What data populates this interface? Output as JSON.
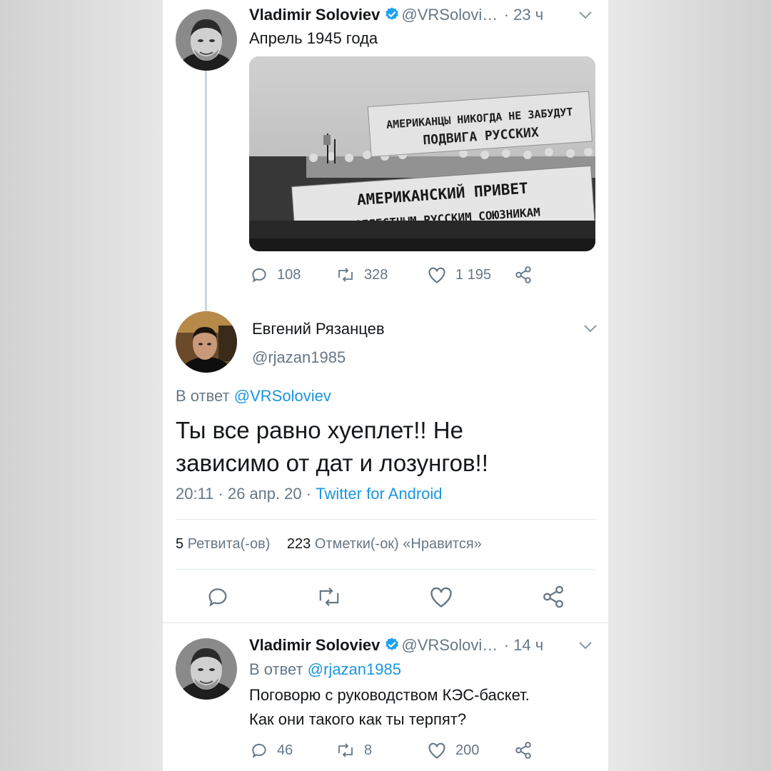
{
  "tweet1": {
    "name": "Vladimir Soloviev",
    "handle": "@VRSolovi…",
    "time": "· 23 ч",
    "text": "Апрель 1945 года",
    "media": {
      "banner_top_line1": "АМЕРИКАНЦЫ НИКОГДА НЕ ЗАБУДУТ",
      "banner_top_line2": "ПОДВИГА РУССКИХ",
      "banner_bottom_line1": "АМЕРИКАНСКИЙ ПРИВЕТ",
      "banner_bottom_line2": "ДОБЛЕСТНЫМ РУССКИМ СОЮЗНИКАМ"
    },
    "replies": "108",
    "retweets": "328",
    "likes": "1 195"
  },
  "tweet2": {
    "name": "Евгений Рязанцев",
    "handle": "@rjazan1985",
    "reply_prefix": "В ответ",
    "reply_to": "@VRSoloviev",
    "text_line1": "Ты все равно хуеплет!! Не",
    "text_line2": "зависимо от дат и лозунгов!!",
    "datetime": "20:11 · 26 апр. 20 ·",
    "source": "Twitter for Android",
    "retweet_count": "5",
    "retweet_label": "Ретвита(-ов)",
    "like_count": "223",
    "like_label": "Отметки(-ок) «Нравится»"
  },
  "tweet3": {
    "name": "Vladimir Soloviev",
    "handle": "@VRSolovi…",
    "time": "· 14 ч",
    "reply_prefix": "В ответ",
    "reply_to": "@rjazan1985",
    "text_line1": "Поговорю с руководством КЭС-баскет.",
    "text_line2": "Как они такого как ты терпят?",
    "replies": "46",
    "retweets": "8",
    "likes": "200"
  },
  "colors": {
    "link": "#1b95e0",
    "muted": "#657786",
    "text": "#14171a",
    "verified": "#1da1f2"
  },
  "icons": [
    "reply-icon",
    "retweet-icon",
    "like-icon",
    "share-icon",
    "verified-badge-icon",
    "chevron-down-icon"
  ]
}
